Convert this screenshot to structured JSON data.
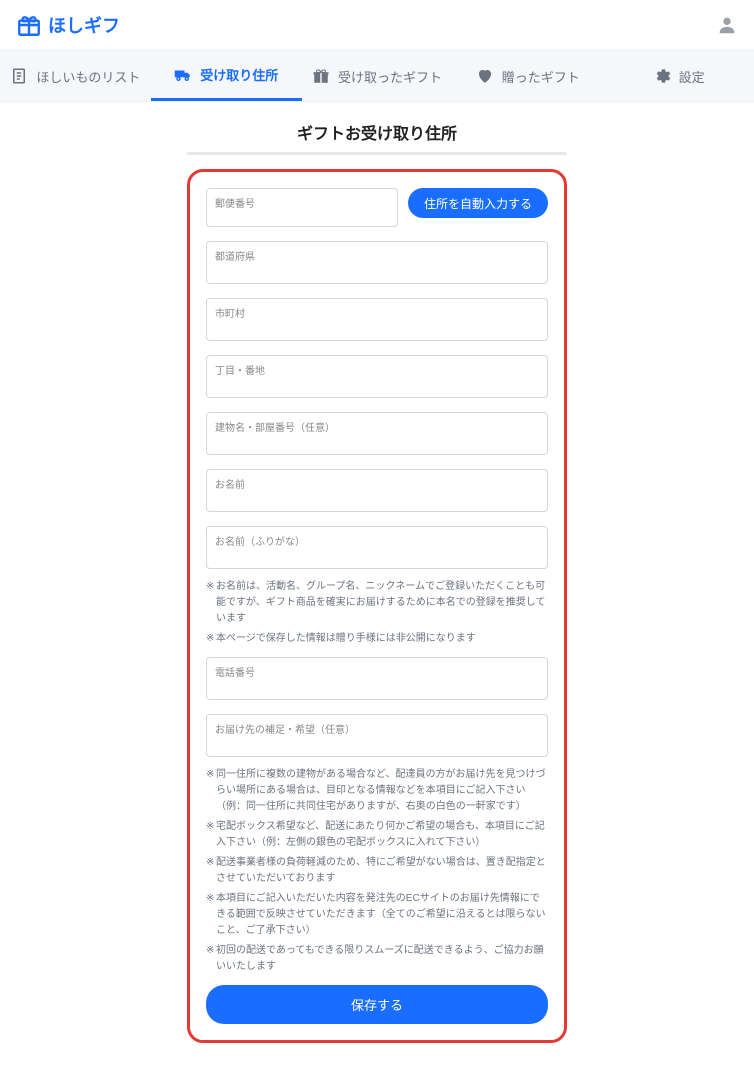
{
  "header": {
    "logo_text": "ほしギフ"
  },
  "tabs": {
    "wishlist": "ほしいものリスト",
    "address": "受け取り住所",
    "received": "受け取ったギフト",
    "sent": "贈ったギフト",
    "settings": "設定"
  },
  "page": {
    "title": "ギフトお受け取り住所"
  },
  "form": {
    "zip_label": "郵便番号",
    "auto_fill_button": "住所を自動入力する",
    "prefecture_label": "都道府県",
    "city_label": "市町村",
    "street_label": "丁目・番地",
    "building_label": "建物名・部屋番号（任意）",
    "name_label": "お名前",
    "name_kana_label": "お名前（ふりがな）",
    "phone_label": "電話番号",
    "delivery_note_label": "お届け先の補足・希望（任意）",
    "name_notes": [
      "お名前は、活動名、グループ名、ニックネームでご登録いただくことも可能ですが、ギフト商品を確実にお届けするために本名での登録を推奨しています",
      "本ページで保存した情報は贈り手様には非公開になります"
    ],
    "delivery_notes": [
      "同一住所に複数の建物がある場合など、配達員の方がお届け先を見つけづらい場所にある場合は、目印となる情報などを本項目にご記入下さい（例：同一住所に共同住宅がありますが、右奥の白色の一軒家です）",
      "宅配ボックス希望など、配送にあたり何かご希望の場合も、本項目にご記入下さい（例：左側の銀色の宅配ボックスに入れて下さい）",
      "配送事業者様の負荷軽減のため、特にご希望がない場合は、置き配指定とさせていただいております",
      "本項目にご記入いただいた内容を発注先のECサイトのお届け先情報にできる範囲で反映させていただきます（全てのご希望に沿えるとは限らないこと、ご了承下さい）",
      "初回の配送であってもできる限りスムーズに配送できるよう、ご協力お願いいたします"
    ],
    "save_button": "保存する"
  }
}
